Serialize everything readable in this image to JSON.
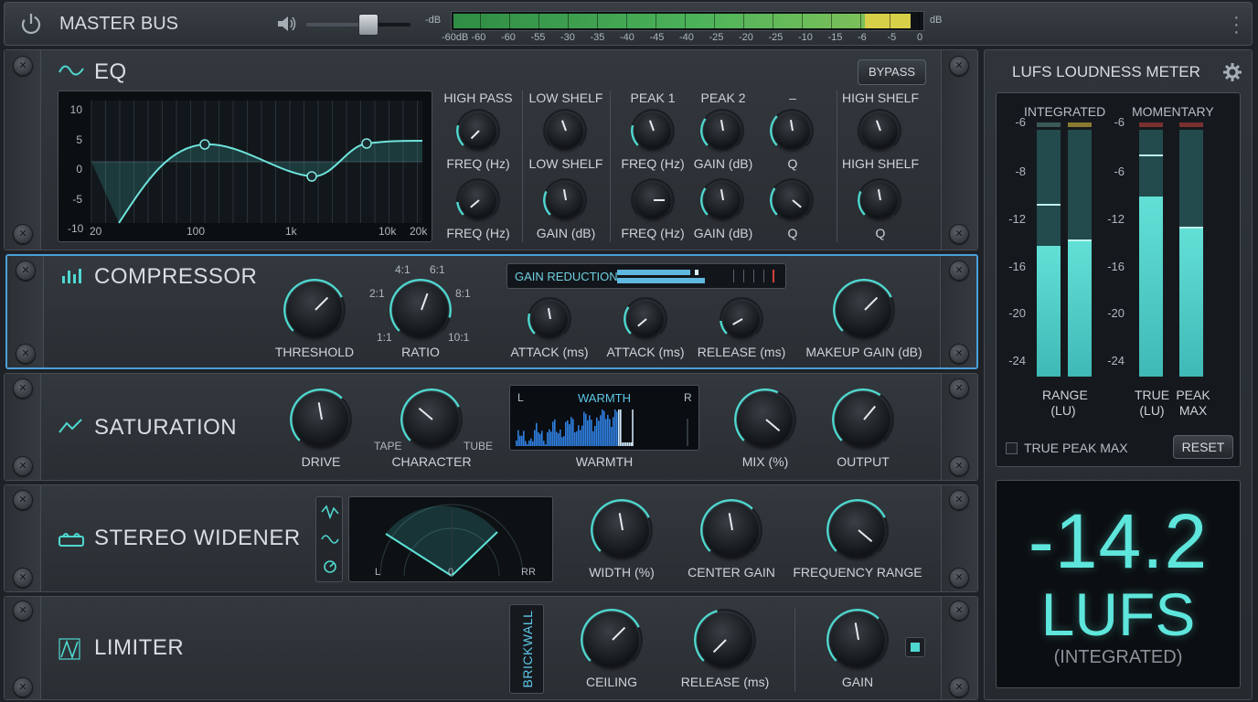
{
  "topbar": {
    "title": "MASTER BUS",
    "db_left": "-dB",
    "db_right": "dB",
    "scale": [
      "-60dB",
      "-60",
      "-60",
      "-55",
      "-30",
      "-35",
      "-40",
      "-45",
      "-40",
      "-25",
      "-20",
      "-25",
      "-10",
      "-15",
      "-6",
      "-5",
      "0"
    ],
    "volume_level": 0.6
  },
  "eq": {
    "title": "EQ",
    "bypass": "BYPASS",
    "y_ticks": [
      "10",
      "5",
      "0",
      "-5",
      "-10"
    ],
    "x_ticks": [
      "20",
      "100",
      "1k",
      "10k",
      "20k"
    ],
    "bands": [
      {
        "head": "HIGH PASS",
        "l1": "FREQ (Hz)",
        "l2": "FREQ (Hz)"
      },
      {
        "head": "LOW SHELF",
        "l1": "LOW SHELF",
        "l2": "GAIN (dB)"
      },
      {
        "head": "PEAK 1",
        "l1": "FREQ (Hz)",
        "l2": "FREQ (Hz)"
      },
      {
        "head": "PEAK 2",
        "l1": "GAIN (dB)",
        "l2": "GAIN (dB)"
      },
      {
        "head": "–",
        "l1": "Q",
        "l2": "Q"
      },
      {
        "head": "HIGH SHELF",
        "l1": "HIGH SHELF",
        "l2": "Q"
      }
    ]
  },
  "compressor": {
    "title": "COMPRESSOR",
    "gain_reduction": "GAIN REDUCTION",
    "ratio_marks": [
      "4:1",
      "6:1",
      "2:1",
      "8:1",
      "1:1",
      "10:1"
    ],
    "threshold": "THRESHOLD",
    "ratio": "RATIO",
    "attack1": "ATTACK (ms)",
    "attack2": "ATTACK (ms)",
    "release": "RELEASE (ms)",
    "makeup": "MAKEUP GAIN (dB)"
  },
  "saturation": {
    "title": "SATURATION",
    "drive": "DRIVE",
    "character": "CHARACTER",
    "tape": "TAPE",
    "tube": "TUBE",
    "warmth_title": "WARMTH",
    "warmth_l": "L",
    "warmth_r": "R",
    "warmth": "WARMTH",
    "mix": "MIX (%)",
    "output": "OUTPUT"
  },
  "widener": {
    "title": "STEREO WIDENER",
    "scope_l": "L",
    "scope_0": "0",
    "scope_r": "RR",
    "width": "WIDTH (%)",
    "center": "CENTER GAIN",
    "freq": "FREQUENCY RANGE"
  },
  "limiter": {
    "title": "LIMITER",
    "brickwall": "BRICKWALL",
    "ceiling": "CEILING",
    "release": "RELEASE (ms)",
    "gain": "GAIN"
  },
  "lufs": {
    "title": "LUFS LOUDNESS METER",
    "integrated": "INTEGRATED",
    "momentary": "MOMENTARY",
    "scale": [
      "-6",
      "-8",
      "-12",
      "-16",
      "-20",
      "-24"
    ],
    "scale_r": [
      "-6",
      "-6",
      "-12",
      "-16",
      "-20",
      "-24"
    ],
    "range": "RANGE",
    "range_sub": "(LU)",
    "true": "TRUE",
    "true_sub": "(LU)",
    "peak": "PEAK",
    "peak_sub": "MAX",
    "true_peak_max": "TRUE PEAK MAX",
    "reset": "RESET",
    "value": "-14.2",
    "unit": "LUFS",
    "sub": "(INTEGRATED)",
    "bars": [
      0.53,
      0.55,
      0.73,
      0.6
    ]
  },
  "colors": {
    "accent": "#4fd8d0",
    "meter_green": "#3fae4e",
    "meter_yellow": "#d8cf48"
  }
}
